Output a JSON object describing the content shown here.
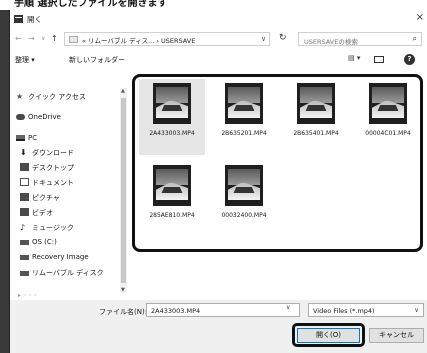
{
  "caption": "手順 選択したファイルを開きます",
  "window": {
    "title": "開く",
    "close_glyph": "×"
  },
  "address": {
    "back": "←",
    "forward": "→",
    "dropdown": "∨",
    "up": "↑",
    "path": "« リムーバブル ディス... › USERSAVE",
    "path_dropdown": "∨",
    "refresh": "↻",
    "search_placeholder": "USERSAVEの検索",
    "search_icon": "⌕"
  },
  "toolbar": {
    "organize": "整理 ▾",
    "new_folder": "新しいフォルダー",
    "view_menu": "▤ ▾",
    "help": "?"
  },
  "nav": {
    "items": [
      {
        "label": "クイック アクセス",
        "icon": "star-icon",
        "glyph": "★"
      },
      {
        "label": "OneDrive",
        "icon": "cloud-icon",
        "glyph": ""
      },
      {
        "label": "PC",
        "icon": "computer-icon",
        "glyph": ""
      },
      {
        "label": "ダウンロード",
        "icon": "download-icon",
        "glyph": "⬇"
      },
      {
        "label": "デスクトップ",
        "icon": "desktop-icon",
        "glyph": ""
      },
      {
        "label": "ドキュメント",
        "icon": "document-icon",
        "glyph": ""
      },
      {
        "label": "ピクチャ",
        "icon": "pictures-icon",
        "glyph": ""
      },
      {
        "label": "ビデオ",
        "icon": "video-icon",
        "glyph": ""
      },
      {
        "label": "ミュージック",
        "icon": "music-icon",
        "glyph": "♪"
      },
      {
        "label": "OS (C:)",
        "icon": "drive-icon",
        "glyph": ""
      },
      {
        "label": "Recovery Image",
        "icon": "drive-icon",
        "glyph": ""
      },
      {
        "label": "リムーバブル ディスク",
        "icon": "removable-drive-icon",
        "glyph": ""
      }
    ]
  },
  "files": [
    {
      "name": "2A433003.MP4",
      "selected": true
    },
    {
      "name": "2B635201.MP4",
      "selected": false
    },
    {
      "name": "2B635401.MP4",
      "selected": false
    },
    {
      "name": "00004C01.MP4",
      "selected": false
    },
    {
      "name": "285AE810.MP4",
      "selected": false
    },
    {
      "name": "00032400.MP4",
      "selected": false
    }
  ],
  "bottom": {
    "filename_label": "ファイル名(N):",
    "filename_value": "2A433003.MP4",
    "filename_dropdown": "∨",
    "filetype": "Video Files (*.mp4)",
    "filetype_dropdown": "∨",
    "open_button": "開く(O)",
    "cancel_button": "キャンセル"
  }
}
